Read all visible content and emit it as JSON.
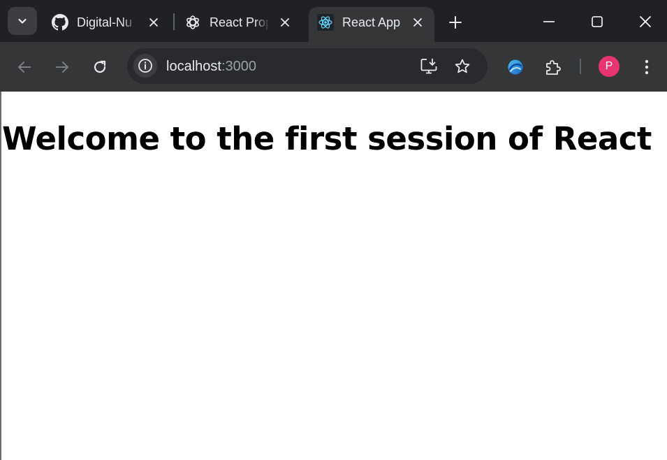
{
  "browser": {
    "tabs": [
      {
        "title": "Digital-Nu",
        "icon": "github-icon",
        "active": false
      },
      {
        "title": "React Prop",
        "icon": "openai-icon",
        "active": false
      },
      {
        "title": "React App",
        "icon": "react-icon",
        "active": true
      }
    ],
    "address_bar": {
      "host": "localhost",
      "port": ":3000"
    },
    "profile_initial": "P",
    "colors": {
      "tabstrip_bg": "#202124",
      "toolbar_bg": "#353638",
      "omnibox_bg": "#282a2d",
      "avatar_bg": "#e8356f",
      "react_accent": "#61dafb"
    }
  },
  "page": {
    "heading": "Welcome to the first session of React"
  }
}
